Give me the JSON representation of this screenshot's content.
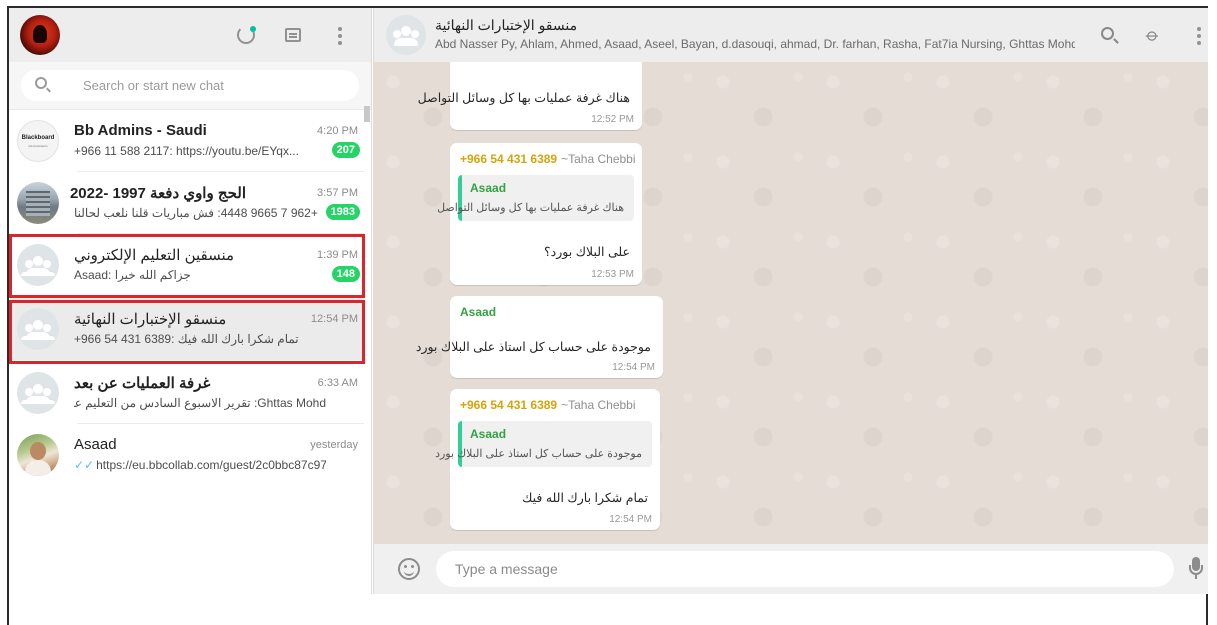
{
  "sidebar": {
    "search_placeholder": "Search or start new chat",
    "chats": [
      {
        "title": "Bb Admins - Saudi",
        "time": "4:20 PM",
        "preview": "+966 11 588 2117: https://youtu.be/EYqx...",
        "unread": "207",
        "avatar": "Blackboard",
        "avatar_sub": "Administrators"
      },
      {
        "title": "الحج واوي دفعة 1997 -2022",
        "time": "3:57 PM",
        "preview": "+962 7 9665 4448: فش مباريات قلنا نلعب لحالنا",
        "unread": "1983",
        "avatar_icon": "building-photo"
      },
      {
        "title": "منسقين التعليم الإلكتروني",
        "time": "1:39 PM",
        "preview": "Asaad: جزاكم الله خيرا",
        "unread": "148",
        "avatar_icon": "group-icon"
      },
      {
        "title": "منسقو الإختبارات النهائية",
        "time": "12:54 PM",
        "preview": "+966 54 431 6389: تمام شكرا بارك الله فيك",
        "avatar_icon": "group-icon"
      },
      {
        "title": "غرفة العمليات عن بعد",
        "time": "6:33 AM",
        "preview": "Ghttas Mohd: تقرير الاسبوع السادس من التعليم عن بعد....",
        "avatar_icon": "group-icon"
      },
      {
        "title": "Asaad",
        "time": "yesterday",
        "preview": "https://eu.bbcollab.com/guest/2c0bbc87c97...",
        "avatar_icon": "person-photo"
      }
    ]
  },
  "conversation": {
    "title": "منسقو الإختبارات النهائية",
    "members": "Abd Nasser Py, Ahlam, Ahmed, Asaad, Aseel, Bayan, d.dasouqi, ahmad, Dr. farhan, Rasha, Fat7ia Nursing, Ghttas Mohd, Ibr...",
    "messages": [
      {
        "text": "هناك غرفة عمليات بها كل وسائل التواصل",
        "time": "12:52 PM"
      },
      {
        "sender": "+966 54 431 6389",
        "alias": "~Taha Chebbi",
        "quote_name": "Asaad",
        "quote_text": "هناك غرفة عمليات بها كل وسائل التواصل",
        "text": "على البلاك بورد؟",
        "time": "12:53 PM"
      },
      {
        "sender": "Asaad",
        "text": "موجودة على حساب كل استاذ على البلاك بورد",
        "time": "12:54 PM"
      },
      {
        "sender": "+966 54 431 6389",
        "alias": "~Taha Chebbi",
        "quote_name": "Asaad",
        "quote_text": "موجودة على حساب كل استاذ على البلاك بورد",
        "text": "تمام شكرا بارك الله فيك",
        "time": "12:54 PM"
      }
    ],
    "input_placeholder": "Type a message"
  },
  "colors": {
    "highlight_box": "#d9262c",
    "unread_badge": "#25d366",
    "chat_bg": "#e5ddd5"
  }
}
